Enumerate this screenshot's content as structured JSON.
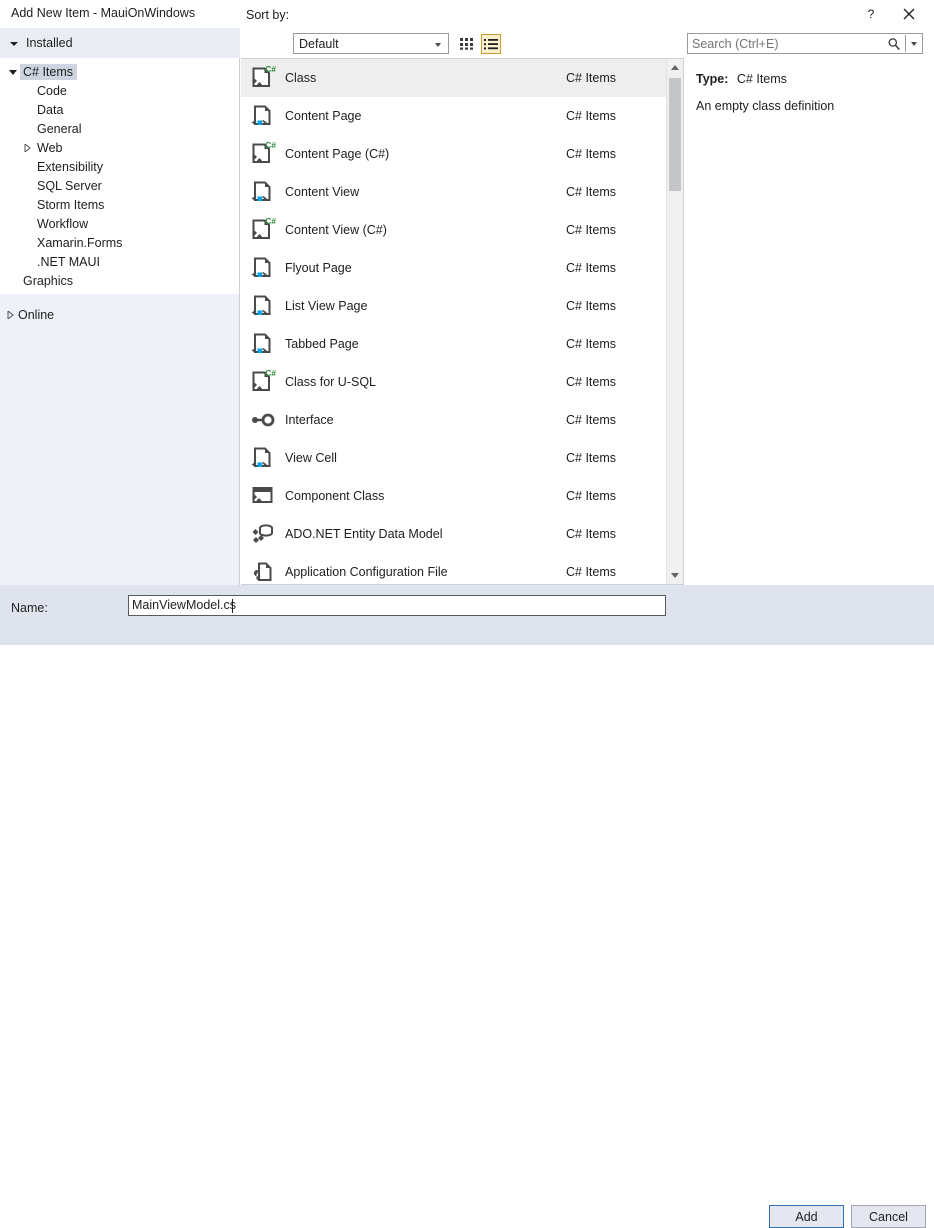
{
  "window": {
    "title": "Add New Item - MauiOnWindows",
    "help_icon": "help-question-icon",
    "close_icon": "close-icon"
  },
  "toolbar": {
    "installed_label": "Installed",
    "sort_by_label": "Sort by:",
    "sort_by_value": "Default",
    "sort_options": [
      "Default"
    ],
    "view_tiles_icon": "grid-tiles-icon",
    "view_list_icon": "list-view-icon",
    "active_view": "list"
  },
  "search": {
    "placeholder": "Search (Ctrl+E)",
    "value": "",
    "icon": "magnifier-icon",
    "dropdown_icon": "chevron-down-icon"
  },
  "tree": {
    "root": {
      "label": "C# Items",
      "expanded": true,
      "selected": true
    },
    "children": [
      {
        "label": "Code",
        "has_arrow": false
      },
      {
        "label": "Data",
        "has_arrow": false
      },
      {
        "label": "General",
        "has_arrow": false
      },
      {
        "label": "Web",
        "has_arrow": true
      },
      {
        "label": "Extensibility",
        "has_arrow": false
      },
      {
        "label": "SQL Server",
        "has_arrow": false
      },
      {
        "label": "Storm Items",
        "has_arrow": false
      },
      {
        "label": "Workflow",
        "has_arrow": false
      },
      {
        "label": "Xamarin.Forms",
        "has_arrow": false
      },
      {
        "label": ".NET MAUI",
        "has_arrow": false
      }
    ],
    "graphics": {
      "label": "Graphics",
      "has_arrow": false
    },
    "online": {
      "label": "Online",
      "has_arrow": true
    }
  },
  "list": {
    "items": [
      {
        "name": "Class",
        "category": "C# Items",
        "icon": "csharp-class-file-icon",
        "selected": true
      },
      {
        "name": "Content Page",
        "category": "C# Items",
        "icon": "xaml-page-icon",
        "selected": false
      },
      {
        "name": "Content Page (C#)",
        "category": "C# Items",
        "icon": "csharp-class-file-icon",
        "selected": false
      },
      {
        "name": "Content View",
        "category": "C# Items",
        "icon": "xaml-page-icon",
        "selected": false
      },
      {
        "name": "Content View (C#)",
        "category": "C# Items",
        "icon": "csharp-class-file-icon",
        "selected": false
      },
      {
        "name": "Flyout Page",
        "category": "C# Items",
        "icon": "xaml-page-icon",
        "selected": false
      },
      {
        "name": "List View Page",
        "category": "C# Items",
        "icon": "xaml-page-icon",
        "selected": false
      },
      {
        "name": "Tabbed Page",
        "category": "C# Items",
        "icon": "xaml-page-icon",
        "selected": false
      },
      {
        "name": "Class for U-SQL",
        "category": "C# Items",
        "icon": "csharp-class-file-icon",
        "selected": false
      },
      {
        "name": "Interface",
        "category": "C# Items",
        "icon": "interface-lollipop-icon",
        "selected": false
      },
      {
        "name": "View Cell",
        "category": "C# Items",
        "icon": "xaml-page-icon",
        "selected": false
      },
      {
        "name": "Component Class",
        "category": "C# Items",
        "icon": "component-class-icon",
        "selected": false
      },
      {
        "name": "ADO.NET Entity Data Model",
        "category": "C# Items",
        "icon": "database-model-icon",
        "selected": false
      },
      {
        "name": "Application Configuration File",
        "category": "C# Items",
        "icon": "wrench-config-file-icon",
        "selected": false
      }
    ],
    "scrollbar": {
      "up_icon": "scroll-up-arrow-icon",
      "down_icon": "scroll-down-arrow-icon"
    }
  },
  "details": {
    "type_label": "Type:",
    "type_value": "C# Items",
    "description": "An empty class definition"
  },
  "bottom": {
    "name_label": "Name:",
    "name_value": "MainViewModel.cs",
    "add_label": "Add",
    "cancel_label": "Cancel"
  },
  "colors": {
    "accent_selection": "#cdd3df",
    "row_selected": "#eeeeee",
    "toggle_active_bg": "#fdf0ce",
    "toggle_active_border": "#c99b28",
    "default_button_border": "#2f6fb5",
    "csharp_green": "#2e8b3c",
    "xaml_blue": "#00a2e8",
    "bottom_bar": "#dfe3ee",
    "tree_panel": "#eef1f7"
  }
}
